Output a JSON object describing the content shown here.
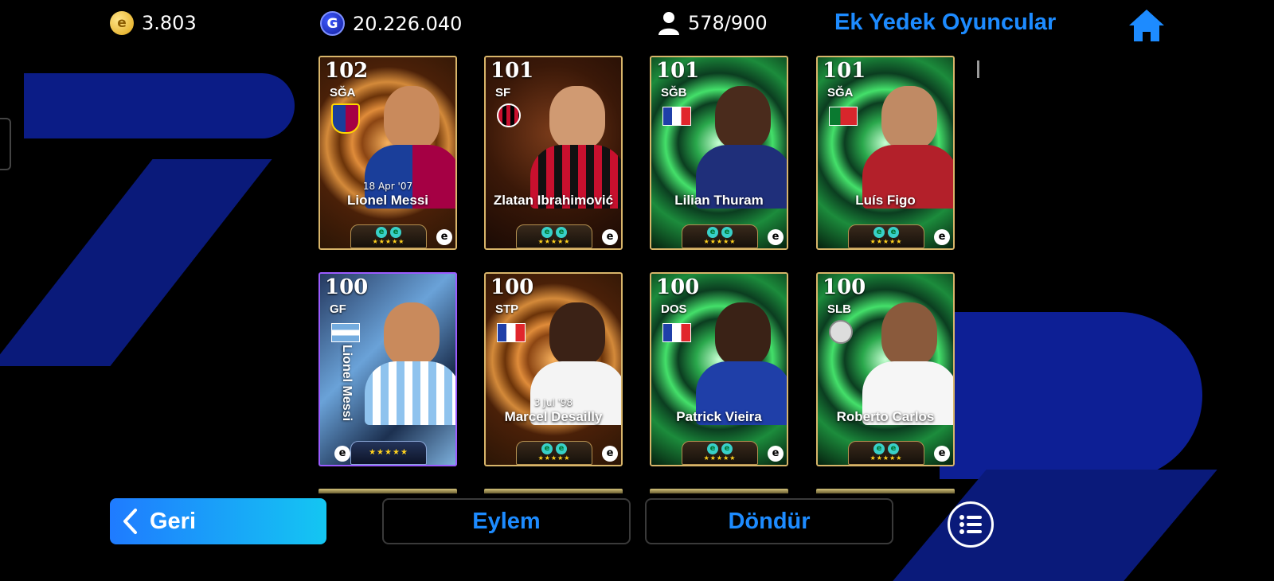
{
  "header": {
    "coins": "3.803",
    "gp": "20.226.040",
    "squad_count": "578/900",
    "title": "Ek Yedek Oyuncular",
    "coin_icon_glyph": "e",
    "gp_icon_glyph": "G"
  },
  "cards": [
    {
      "rating": "102",
      "position": "SĞA",
      "name": "Lionel Messi",
      "date": "18 Apr '07"
    },
    {
      "rating": "101",
      "position": "SF",
      "name": "Zlatan Ibrahimović",
      "date": ""
    },
    {
      "rating": "101",
      "position": "SĞB",
      "name": "Lilian Thuram",
      "date": ""
    },
    {
      "rating": "101",
      "position": "SĞA",
      "name": "Luís Figo",
      "date": ""
    },
    {
      "rating": "100",
      "position": "GF",
      "name": "Lionel Messi",
      "date": ""
    },
    {
      "rating": "100",
      "position": "STP",
      "name": "Marcel Desailly",
      "date": "3 Jul '98"
    },
    {
      "rating": "100",
      "position": "DOS",
      "name": "Patrick Vieira",
      "date": ""
    },
    {
      "rating": "100",
      "position": "SLB",
      "name": "Roberto Carlos",
      "date": ""
    }
  ],
  "card_common": {
    "stars": "★★★★★",
    "skill_glyph": "e",
    "brand_glyph": "e"
  },
  "footer": {
    "back_label": "Geri",
    "action_label": "Eylem",
    "rotate_label": "Döndür"
  },
  "colors": {
    "accent": "#1d8bff",
    "back_gradient_start": "#1f7bff",
    "back_gradient_end": "#14c6f2"
  }
}
